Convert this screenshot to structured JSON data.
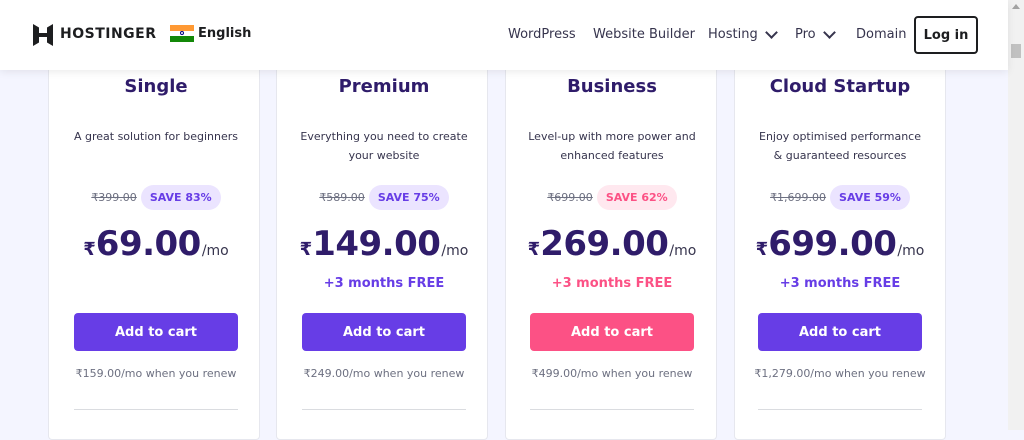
{
  "header": {
    "brand": "HOSTINGER",
    "language": "English",
    "nav": [
      "WordPress",
      "Website Builder",
      "Hosting",
      "Pro",
      "Domain"
    ],
    "login": "Log in"
  },
  "plans": [
    {
      "title": "Single",
      "desc1": "A great solution for beginners",
      "desc2": "",
      "old_price": "₹399.00",
      "save": "SAVE 83%",
      "currency": "₹",
      "price": "69.00",
      "per": "/mo",
      "free": "",
      "cart": "Add to cart",
      "renew": "₹159.00/mo when you renew"
    },
    {
      "title": "Premium",
      "desc1": "Everything you need to create",
      "desc2": "your website",
      "old_price": "₹589.00",
      "save": "SAVE 75%",
      "currency": "₹",
      "price": "149.00",
      "per": "/mo",
      "free": "+3 months FREE",
      "cart": "Add to cart",
      "renew": "₹249.00/mo when you renew"
    },
    {
      "title": "Business",
      "desc1": "Level-up with more power and",
      "desc2": "enhanced features",
      "old_price": "₹699.00",
      "save": "SAVE 62%",
      "currency": "₹",
      "price": "269.00",
      "per": "/mo",
      "free": "+3 months FREE",
      "cart": "Add to cart",
      "renew": "₹499.00/mo when you renew"
    },
    {
      "title": "Cloud Startup",
      "desc1": "Enjoy optimised performance",
      "desc2": "& guaranteed resources",
      "old_price": "₹1,699.00",
      "save": "SAVE 59%",
      "currency": "₹",
      "price": "699.00",
      "per": "/mo",
      "free": "+3 months FREE",
      "cart": "Add to cart",
      "renew": "₹1,279.00/mo when you renew"
    }
  ],
  "colors": {
    "primary": "#673de6",
    "accent": "#fc5185",
    "heading": "#2f1c6a"
  },
  "icons": [
    "hostinger-logo-icon",
    "india-flag-icon",
    "chevron-down-icon"
  ]
}
